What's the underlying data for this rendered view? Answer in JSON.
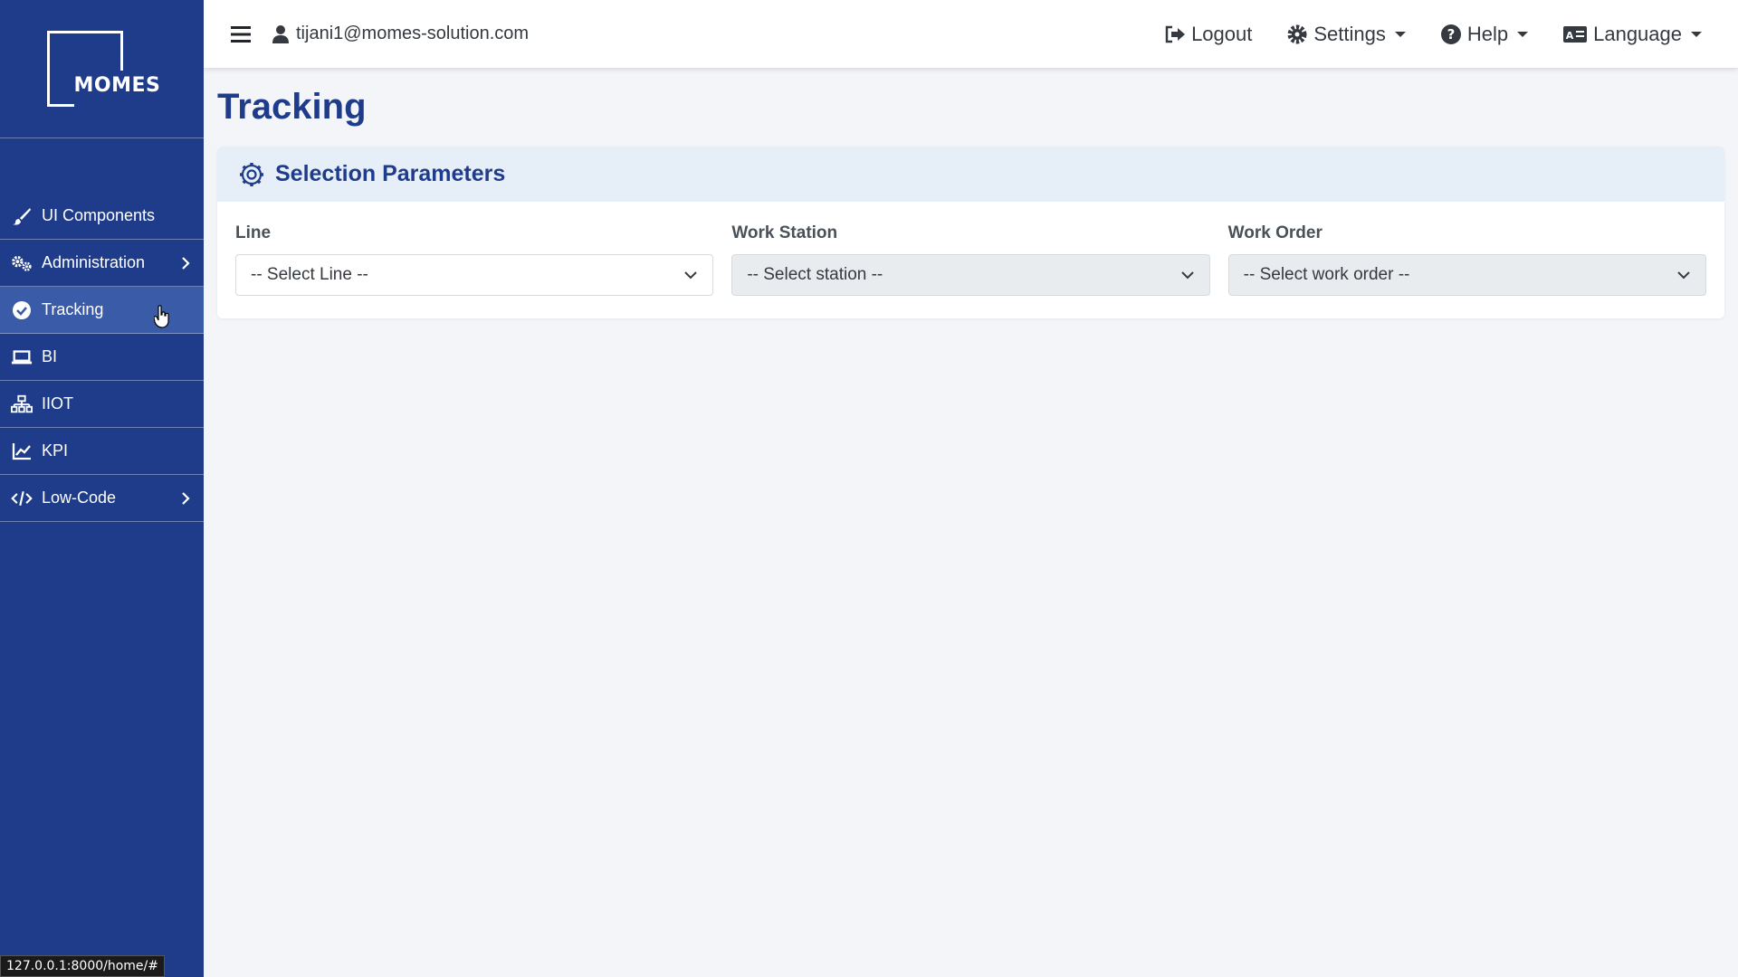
{
  "sidebar": {
    "logo_text": "MOMES",
    "items": [
      {
        "label": "UI Components",
        "icon": "brush-icon"
      },
      {
        "label": "Administration",
        "icon": "gears-icon",
        "has_children": true
      },
      {
        "label": "Tracking",
        "icon": "check-circle-icon",
        "active": true
      },
      {
        "label": "BI",
        "icon": "laptop-icon"
      },
      {
        "label": "IIOT",
        "icon": "network-icon"
      },
      {
        "label": "KPI",
        "icon": "line-chart-icon"
      },
      {
        "label": "Low-Code",
        "icon": "code-icon",
        "has_children": true
      }
    ],
    "status_url": "127.0.0.1:8000/home/#"
  },
  "topbar": {
    "user_email": "tijani1@momes-solution.com",
    "logout_label": "Logout",
    "settings_label": "Settings",
    "help_label": "Help",
    "language_label": "Language"
  },
  "main": {
    "page_title": "Tracking",
    "card": {
      "title": "Selection Parameters",
      "fields": [
        {
          "label": "Line",
          "value": "-- Select Line --"
        },
        {
          "label": "Work Station",
          "value": "-- Select station --"
        },
        {
          "label": "Work Order",
          "value": "-- Select work order --"
        }
      ]
    }
  },
  "colors": {
    "sidebar_bg": "#1f3c8b",
    "active_item_bg": "#3a5ba8",
    "accent": "#1f3c8b",
    "card_header_bg": "#e6eef7",
    "page_bg": "#f3f5f9"
  }
}
